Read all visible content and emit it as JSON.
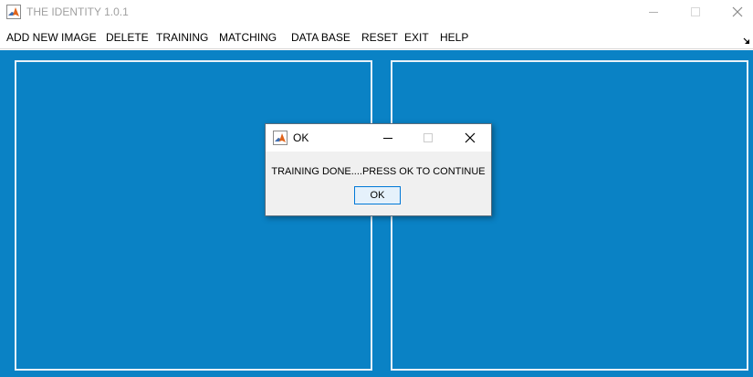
{
  "window": {
    "title": "THE IDENTITY 1.0.1",
    "icon": "matlab-icon"
  },
  "menu": {
    "items": [
      {
        "label": "ADD NEW IMAGE"
      },
      {
        "label": "DELETE"
      },
      {
        "label": "TRAINING"
      },
      {
        "label": "MATCHING"
      },
      {
        "label": "DATA BASE"
      },
      {
        "label": "RESET"
      },
      {
        "label": "EXIT"
      },
      {
        "label": "HELP"
      }
    ]
  },
  "dialog": {
    "title": "OK",
    "message": "TRAINING DONE....PRESS OK TO CONTINUE",
    "ok_label": "OK"
  },
  "colors": {
    "canvas_background": "#0a82c5",
    "panel_border": "#e8f1f8",
    "dialog_background": "#f0f0f0",
    "button_accent": "#0078d7"
  }
}
